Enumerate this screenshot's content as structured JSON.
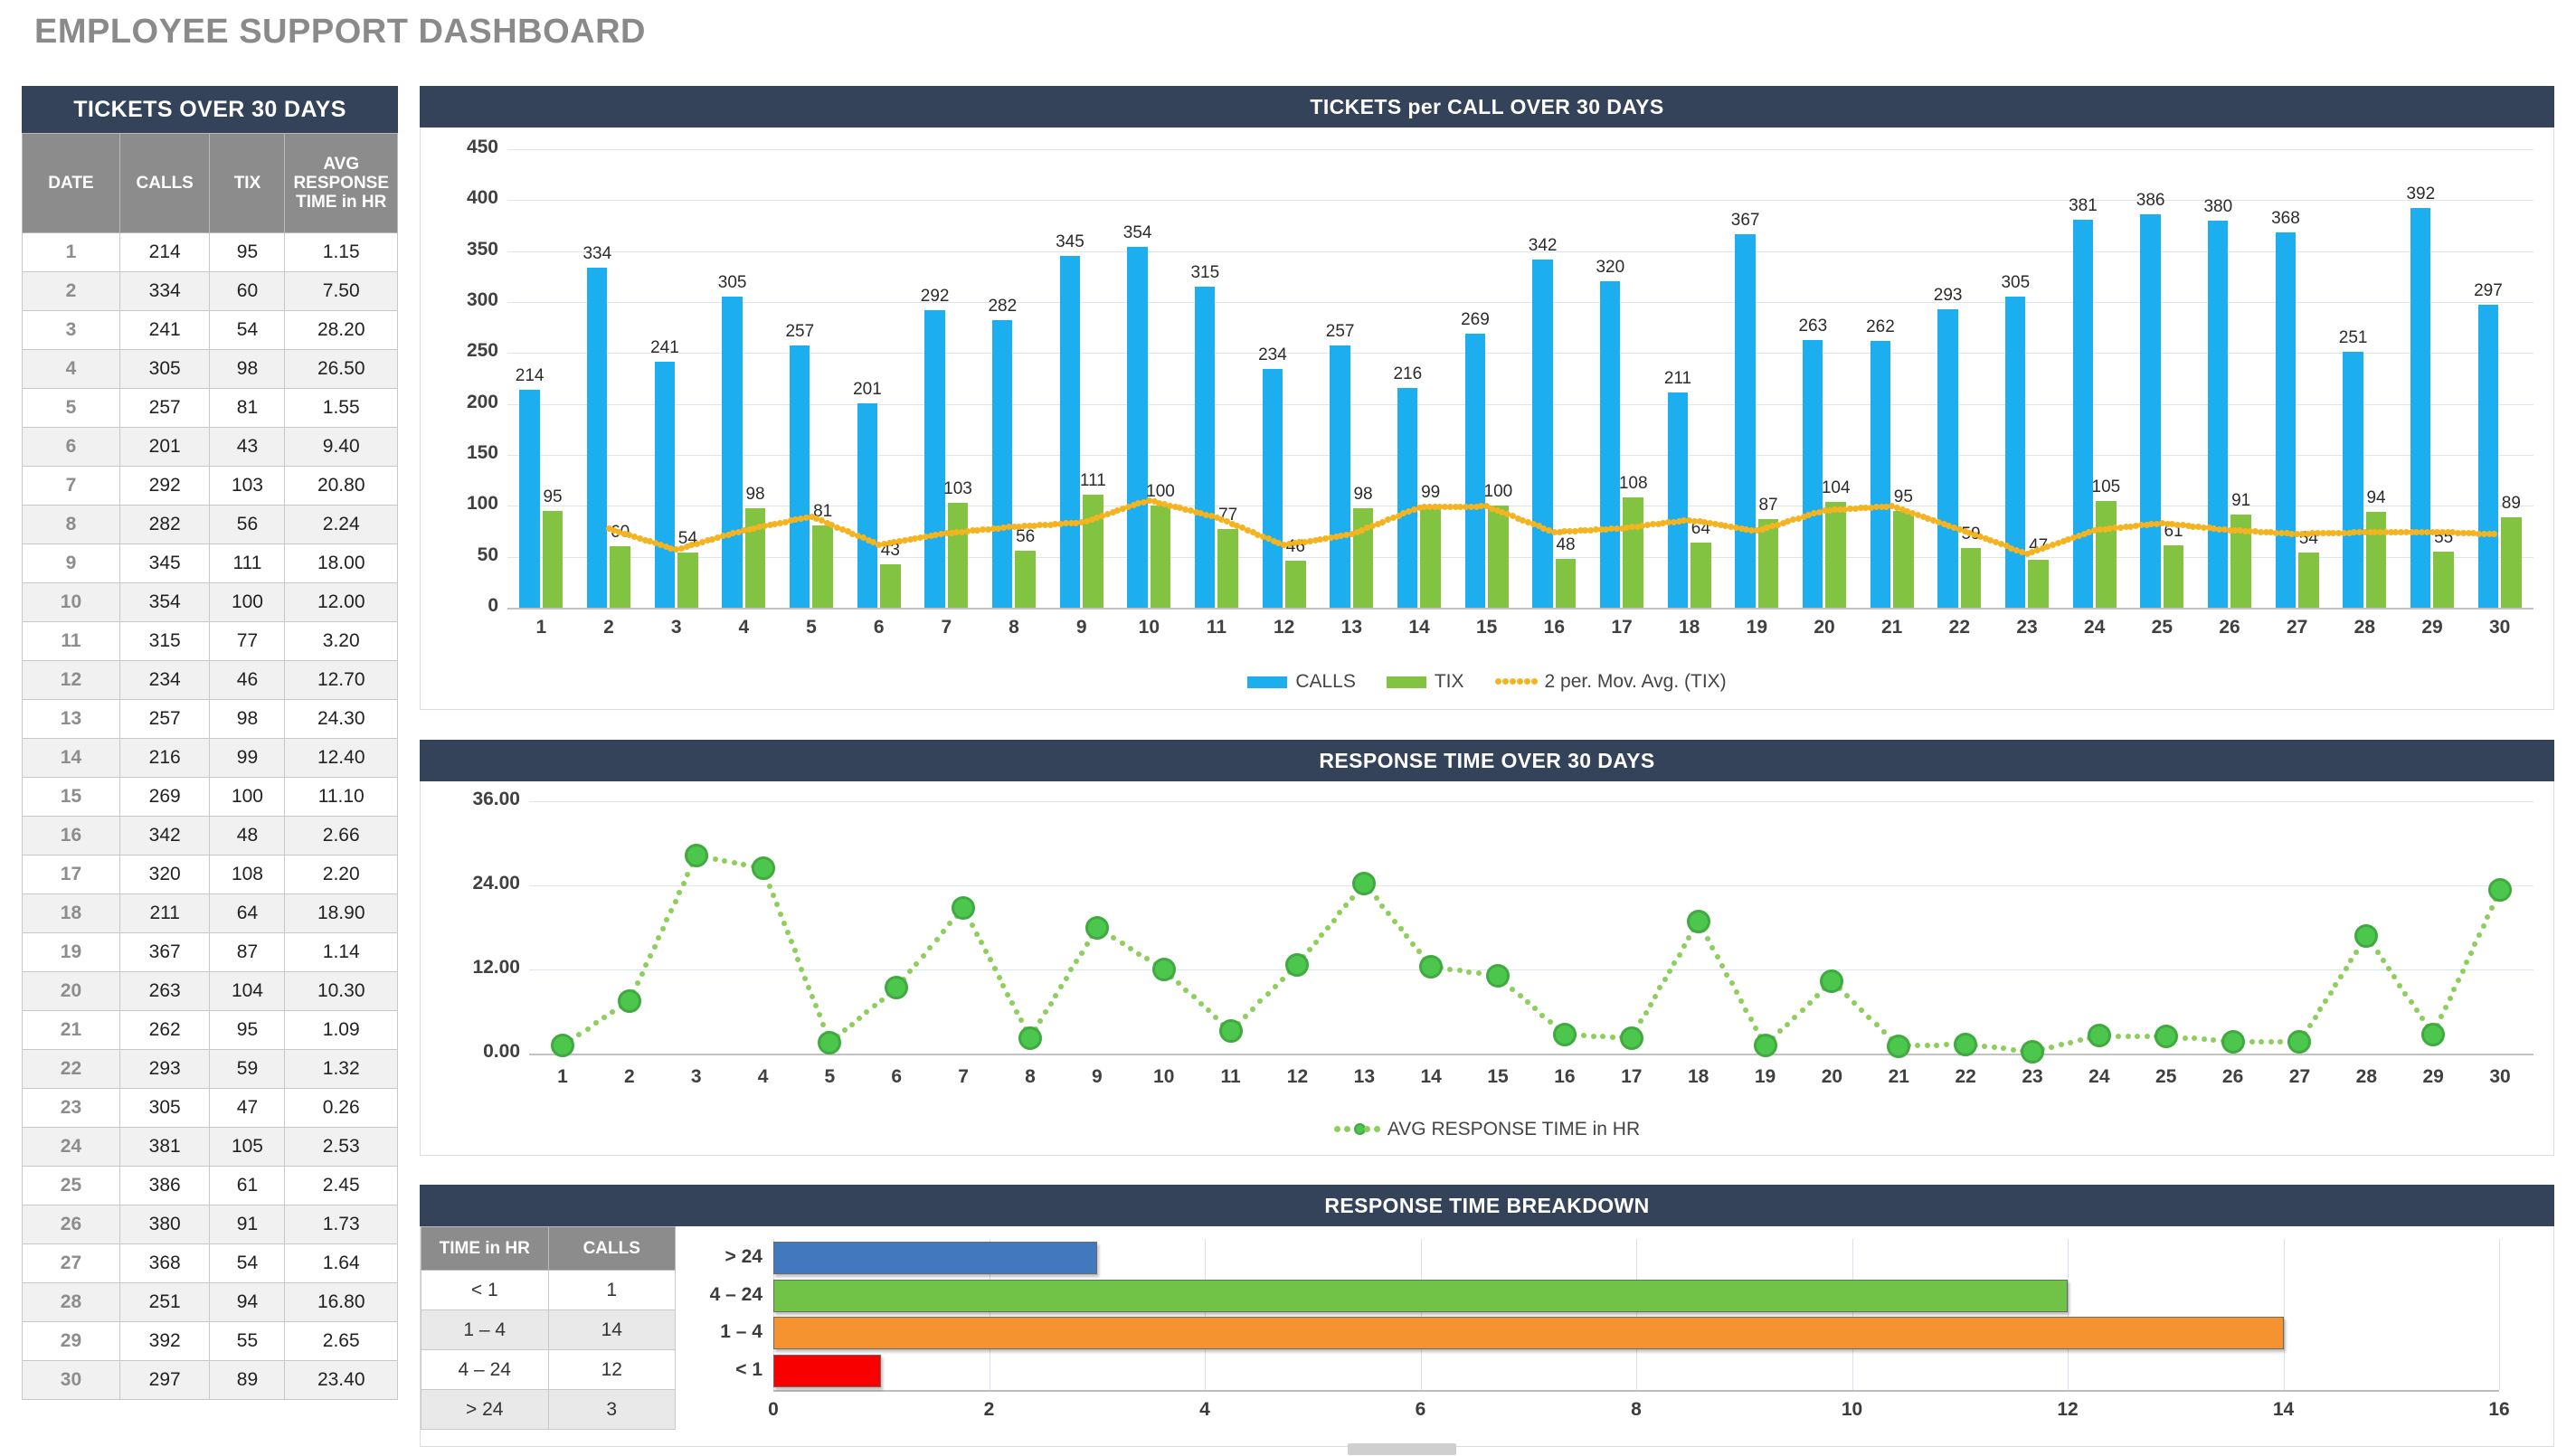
{
  "page": {
    "title": "EMPLOYEE SUPPORT DASHBOARD"
  },
  "colors": {
    "header_navy": "#35435a",
    "header_gray": "#8c8c8c",
    "calls_blue": "#1caeef",
    "tix_green": "#82c341",
    "movavg_orange": "#f4b422",
    "response_green": "#4dc64d",
    "bd_gt24_blue": "#4178be",
    "bd_4_24_green": "#71c348",
    "bd_1_4_orange": "#f59331",
    "bd_lt1_red": "#f80000"
  },
  "left_table": {
    "title": "TICKETS OVER 30 DAYS",
    "columns": [
      "DATE",
      "CALLS",
      "TIX",
      "AVG RESPONSE TIME in HR"
    ],
    "rows": [
      [
        "1",
        "214",
        "95",
        "1.15"
      ],
      [
        "2",
        "334",
        "60",
        "7.50"
      ],
      [
        "3",
        "241",
        "54",
        "28.20"
      ],
      [
        "4",
        "305",
        "98",
        "26.50"
      ],
      [
        "5",
        "257",
        "81",
        "1.55"
      ],
      [
        "6",
        "201",
        "43",
        "9.40"
      ],
      [
        "7",
        "292",
        "103",
        "20.80"
      ],
      [
        "8",
        "282",
        "56",
        "2.24"
      ],
      [
        "9",
        "345",
        "111",
        "18.00"
      ],
      [
        "10",
        "354",
        "100",
        "12.00"
      ],
      [
        "11",
        "315",
        "77",
        "3.20"
      ],
      [
        "12",
        "234",
        "46",
        "12.70"
      ],
      [
        "13",
        "257",
        "98",
        "24.30"
      ],
      [
        "14",
        "216",
        "99",
        "12.40"
      ],
      [
        "15",
        "269",
        "100",
        "11.10"
      ],
      [
        "16",
        "342",
        "48",
        "2.66"
      ],
      [
        "17",
        "320",
        "108",
        "2.20"
      ],
      [
        "18",
        "211",
        "64",
        "18.90"
      ],
      [
        "19",
        "367",
        "87",
        "1.14"
      ],
      [
        "20",
        "263",
        "104",
        "10.30"
      ],
      [
        "21",
        "262",
        "95",
        "1.09"
      ],
      [
        "22",
        "293",
        "59",
        "1.32"
      ],
      [
        "23",
        "305",
        "47",
        "0.26"
      ],
      [
        "24",
        "381",
        "105",
        "2.53"
      ],
      [
        "25",
        "386",
        "61",
        "2.45"
      ],
      [
        "26",
        "380",
        "91",
        "1.73"
      ],
      [
        "27",
        "368",
        "54",
        "1.64"
      ],
      [
        "28",
        "251",
        "94",
        "16.80"
      ],
      [
        "29",
        "392",
        "55",
        "2.65"
      ],
      [
        "30",
        "297",
        "89",
        "23.40"
      ]
    ]
  },
  "chart1": {
    "title": "TICKETS per CALL OVER 30 DAYS"
  },
  "chart2": {
    "title": "RESPONSE TIME OVER 30 DAYS"
  },
  "chart3": {
    "title": "RESPONSE TIME BREAKDOWN",
    "table": {
      "columns": [
        "TIME in HR",
        "CALLS"
      ],
      "rows": [
        [
          "< 1",
          "1"
        ],
        [
          "1 – 4",
          "14"
        ],
        [
          "4 – 24",
          "12"
        ],
        [
          "> 24",
          "3"
        ]
      ]
    }
  },
  "chart_data": [
    {
      "type": "bar",
      "title": "TICKETS per CALL OVER 30 DAYS",
      "xlabel": "",
      "ylabel": "",
      "ylim": [
        0,
        450
      ],
      "yticks": [
        0,
        50,
        100,
        150,
        200,
        250,
        300,
        350,
        400,
        450
      ],
      "grid": true,
      "legend_position": "bottom",
      "categories": [
        "1",
        "2",
        "3",
        "4",
        "5",
        "6",
        "7",
        "8",
        "9",
        "10",
        "11",
        "12",
        "13",
        "14",
        "15",
        "16",
        "17",
        "18",
        "19",
        "20",
        "21",
        "22",
        "23",
        "24",
        "25",
        "26",
        "27",
        "28",
        "29",
        "30"
      ],
      "series": [
        {
          "name": "CALLS",
          "type": "bar",
          "color": "#1caeef",
          "values": [
            214,
            334,
            241,
            305,
            257,
            201,
            292,
            282,
            345,
            354,
            315,
            234,
            257,
            216,
            269,
            342,
            320,
            211,
            367,
            263,
            262,
            293,
            305,
            381,
            386,
            380,
            368,
            251,
            392,
            297
          ]
        },
        {
          "name": "TIX",
          "type": "bar",
          "color": "#82c341",
          "values": [
            95,
            60,
            54,
            98,
            81,
            43,
            103,
            56,
            111,
            100,
            77,
            46,
            98,
            99,
            100,
            48,
            108,
            64,
            87,
            104,
            95,
            59,
            47,
            105,
            61,
            91,
            54,
            94,
            55,
            89
          ]
        },
        {
          "name": "2 per. Mov. Avg. (TIX)",
          "type": "line",
          "style": "dotted",
          "color": "#f4b422",
          "values": [
            null,
            77.5,
            57,
            76,
            89.5,
            62,
            73,
            79.5,
            83.5,
            105.5,
            88.5,
            61.5,
            72,
            98.5,
            99.5,
            74,
            78,
            86,
            75.5,
            95.5,
            99.5,
            77,
            53,
            76,
            83,
            76,
            72.5,
            74,
            74.5,
            72
          ]
        }
      ]
    },
    {
      "type": "line",
      "title": "RESPONSE TIME OVER 30 DAYS",
      "xlabel": "",
      "ylabel": "",
      "ylim": [
        0,
        36
      ],
      "yticks": [
        "0.00",
        "12.00",
        "24.00",
        "36.00"
      ],
      "grid": true,
      "legend_position": "bottom",
      "x": [
        "1",
        "2",
        "3",
        "4",
        "5",
        "6",
        "7",
        "8",
        "9",
        "10",
        "11",
        "12",
        "13",
        "14",
        "15",
        "16",
        "17",
        "18",
        "19",
        "20",
        "21",
        "22",
        "23",
        "24",
        "25",
        "26",
        "27",
        "28",
        "29",
        "30"
      ],
      "series": [
        {
          "name": "AVG RESPONSE TIME in HR",
          "color": "#4dc64d",
          "style": "dotted-markers",
          "values": [
            1.15,
            7.5,
            28.2,
            26.5,
            1.55,
            9.4,
            20.8,
            2.24,
            18.0,
            12.0,
            3.2,
            12.7,
            24.3,
            12.4,
            11.1,
            2.66,
            2.2,
            18.9,
            1.14,
            10.3,
            1.09,
            1.32,
            0.26,
            2.53,
            2.45,
            1.73,
            1.64,
            16.8,
            2.65,
            23.4
          ]
        }
      ]
    },
    {
      "type": "bar",
      "orientation": "horizontal",
      "title": "RESPONSE TIME BREAKDOWN",
      "xlabel": "",
      "ylabel": "",
      "xlim": [
        0,
        16
      ],
      "xticks": [
        0,
        2,
        4,
        6,
        8,
        10,
        12,
        14,
        16
      ],
      "grid": true,
      "categories": [
        "< 1",
        "1 – 4",
        "4 – 24",
        "> 24"
      ],
      "values": [
        1,
        14,
        12,
        3
      ],
      "bar_colors": [
        "#f80000",
        "#f59331",
        "#71c348",
        "#4178be"
      ]
    }
  ],
  "chart1_axis": {
    "yticks": [
      "450",
      "400",
      "350",
      "300",
      "250",
      "200",
      "150",
      "100",
      "50",
      "0"
    ],
    "xticks": [
      "1",
      "2",
      "3",
      "4",
      "5",
      "6",
      "7",
      "8",
      "9",
      "10",
      "11",
      "12",
      "13",
      "14",
      "15",
      "16",
      "17",
      "18",
      "19",
      "20",
      "21",
      "22",
      "23",
      "24",
      "25",
      "26",
      "27",
      "28",
      "29",
      "30"
    ],
    "legend": [
      {
        "label": "CALLS",
        "kind": "swatch",
        "color": "#1caeef"
      },
      {
        "label": "TIX",
        "kind": "swatch",
        "color": "#82c341"
      },
      {
        "label": "2 per. Mov. Avg. (TIX)",
        "kind": "dots",
        "color": "#f4b422"
      }
    ]
  },
  "chart2_axis": {
    "yticks": [
      "36.00",
      "24.00",
      "12.00",
      "0.00"
    ],
    "xticks": [
      "1",
      "2",
      "3",
      "4",
      "5",
      "6",
      "7",
      "8",
      "9",
      "10",
      "11",
      "12",
      "13",
      "14",
      "15",
      "16",
      "17",
      "18",
      "19",
      "20",
      "21",
      "22",
      "23",
      "24",
      "25",
      "26",
      "27",
      "28",
      "29",
      "30"
    ],
    "legend": [
      {
        "label": "AVG RESPONSE TIME in HR",
        "kind": "dots-marker",
        "color": "#4dc64d"
      }
    ]
  },
  "chart3_axis": {
    "xticks": [
      "0",
      "2",
      "4",
      "6",
      "8",
      "10",
      "12",
      "14",
      "16"
    ],
    "categories": [
      "> 24",
      "4 – 24",
      "1 – 4",
      "< 1"
    ]
  }
}
